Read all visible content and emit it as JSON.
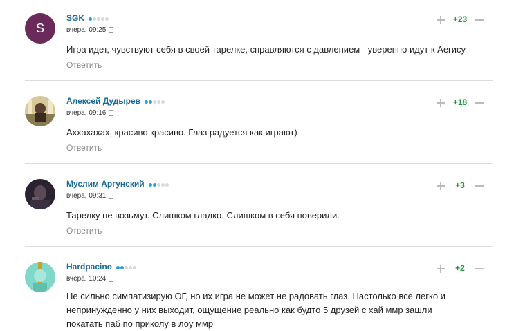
{
  "reply_label": "Ответить",
  "comments": [
    {
      "author": "SGK",
      "avatar_letter": "S",
      "rating_dots": 1,
      "time": "вчера, 09:25",
      "score": "+23",
      "text": "Игра идет, чувствуют себя в своей тарелке, справляются с давлением - уверенно идут к Аегису"
    },
    {
      "author": "Алексей Дудырев",
      "rating_dots": 2,
      "time": "вчера, 09:16",
      "score": "+18",
      "text": "Аххахахах, красиво красиво. Глаз радуется как играют)"
    },
    {
      "author": "Муслим Аргунский",
      "rating_dots": 2,
      "time": "вчера, 09:31",
      "score": "+3",
      "text": "Тарелку не возьмут. Слишком гладко. Слишком в себя поверили."
    },
    {
      "author": "Hardpacino",
      "rating_dots": 2,
      "time": "вчера, 10:24",
      "score": "+2",
      "text_lines": [
        "Не сильно симпатизирую ОГ, но их игра не может не радовать глаз. Настолько все легко и",
        "непринужденно у них выходит, ощущение реально как будто 5 друзей с хай ммр зашли",
        "покатать паб по приколу в лоу ммр"
      ]
    }
  ]
}
